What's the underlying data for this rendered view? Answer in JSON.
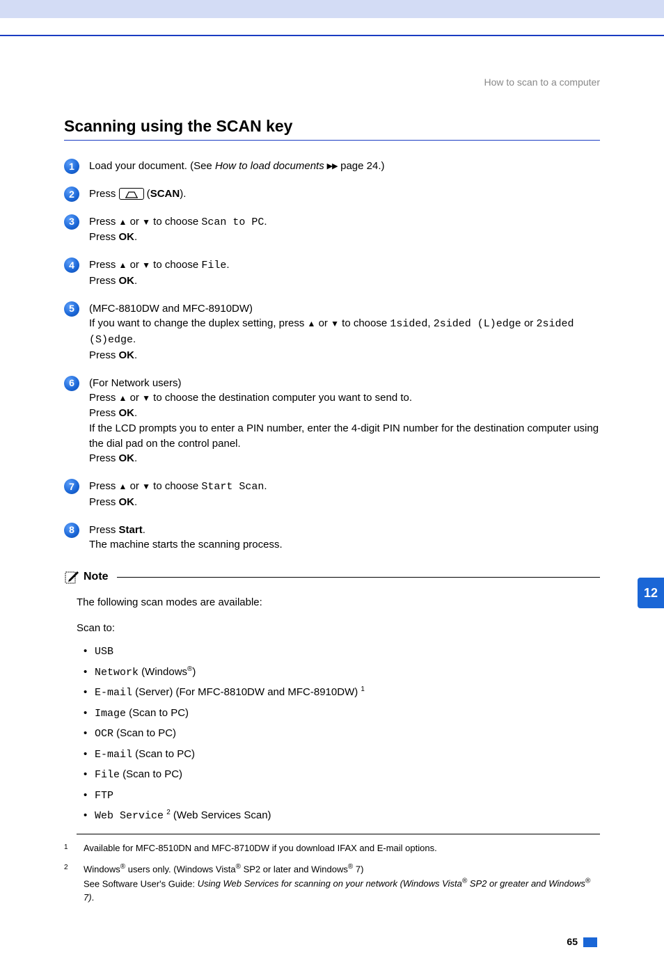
{
  "breadcrumb": "How to scan to a computer",
  "title": "Scanning using the SCAN key",
  "tab_number": "12",
  "page_number": "65",
  "steps": {
    "s1": {
      "a": "Load your document. (See ",
      "b": "How to load documents",
      "c": " page 24.)"
    },
    "s2": {
      "a": "Press ",
      "b": " (",
      "c": "SCAN",
      "d": ")."
    },
    "s3": {
      "a": "Press ",
      "up": "▲",
      "mid": " or ",
      "down": "▼",
      "b": " to choose ",
      "code": "Scan to PC",
      "dot": ".",
      "press": "Press ",
      "ok": "OK",
      "dot2": "."
    },
    "s4": {
      "a": "Press ",
      "up": "▲",
      "mid": " or ",
      "down": "▼",
      "b": " to choose ",
      "code": "File",
      "dot": ".",
      "press": "Press ",
      "ok": "OK",
      "dot2": "."
    },
    "s5": {
      "models": "(MFC-8810DW and MFC-8910DW)",
      "a": "If you want to change the duplex setting, press ",
      "up": "▲",
      "mid": " or ",
      "down": "▼",
      "b": " to choose ",
      "c1": "1sided",
      "comma": ", ",
      "c2": "2sided (L)edge",
      "or": " or ",
      "c3": "2sided (S)edge",
      "dot": ".",
      "press": "Press ",
      "ok": "OK",
      "dot2": "."
    },
    "s6": {
      "head": "(For Network users)",
      "a": "Press ",
      "up": "▲",
      "mid": " or ",
      "down": "▼",
      "b": " to choose the destination computer you want to send to.",
      "press1": "Press ",
      "ok1": "OK",
      "dot1": ".",
      "line3": "If the LCD prompts you to enter a PIN number, enter the 4-digit PIN number for the destination computer using the dial pad on the control panel.",
      "press2": "Press ",
      "ok2": "OK",
      "dot2": "."
    },
    "s7": {
      "a": "Press ",
      "up": "▲",
      "mid": " or ",
      "down": "▼",
      "b": " to choose ",
      "code": "Start Scan",
      "dot": ".",
      "press": "Press ",
      "ok": "OK",
      "dot2": "."
    },
    "s8": {
      "a": "Press ",
      "start": "Start",
      "dot": ".",
      "line2": "The machine starts the scanning process."
    }
  },
  "note": {
    "label": "Note",
    "intro": "The following scan modes are available:",
    "scanto": "Scan to:",
    "bullets": {
      "b1": {
        "code": "USB"
      },
      "b2": {
        "code": "Network",
        "rest_a": " (Windows",
        "rest_b": ")"
      },
      "b3": {
        "code": "E-mail",
        "rest": " (Server) (For MFC-8810DW and MFC-8910DW) ",
        "sup": "1"
      },
      "b4": {
        "code": "Image",
        "rest": " (Scan to PC)"
      },
      "b5": {
        "code": "OCR",
        "rest": " (Scan to PC)"
      },
      "b6": {
        "code": "E-mail",
        "rest": " (Scan to PC)"
      },
      "b7": {
        "code": "File",
        "rest": " (Scan to PC)"
      },
      "b8": {
        "code": "FTP"
      },
      "b9": {
        "code": "Web Service",
        "sup": "2",
        "rest": " (Web Services Scan)"
      }
    }
  },
  "footnotes": {
    "f1": {
      "num": "1",
      "text": "Available for MFC-8510DN and MFC-8710DW if you download IFAX and E-mail options."
    },
    "f2": {
      "num": "2",
      "a": "Windows",
      "b": " users only. (Windows Vista",
      "c": " SP2 or later and Windows",
      "d": " 7)",
      "line2a": "See Software User's Guide: ",
      "line2b": "Using Web Services for scanning on your network (Windows Vista",
      "line2c": " SP2 or greater and Windows",
      "line2d": " 7)",
      "line2e": "."
    }
  }
}
